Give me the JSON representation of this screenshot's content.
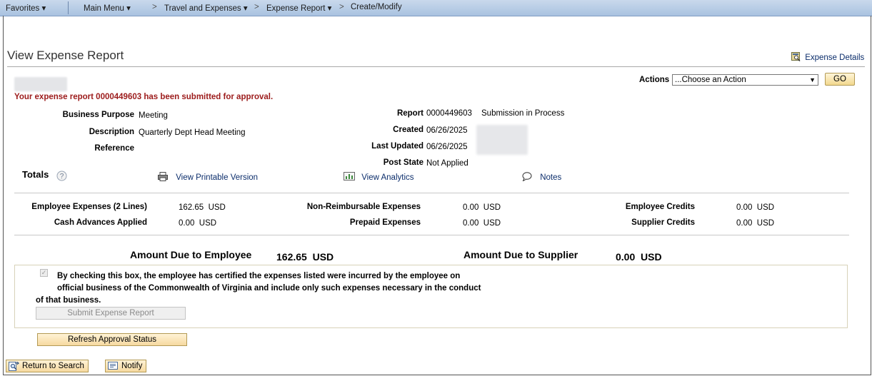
{
  "nav": {
    "favorites": "Favorites",
    "main_menu": "Main Menu",
    "crumb_sep": ">",
    "travel": "Travel and Expenses",
    "expense_report": "Expense Report",
    "create_modify": "Create/Modify"
  },
  "page": {
    "title": "View Expense Report",
    "expense_details_link": "Expense Details",
    "message": "Your expense report 0000449603 has been submitted for approval."
  },
  "actions": {
    "label": "Actions",
    "selected": "...Choose an Action",
    "go": "GO"
  },
  "header_fields": {
    "business_purpose_label": "Business Purpose",
    "business_purpose": "Meeting",
    "description_label": "Description",
    "description": "Quarterly Dept Head Meeting",
    "reference_label": "Reference",
    "reference": "",
    "report_label": "Report",
    "report_id": "0000449603",
    "report_status": "Submission in Process",
    "created_label": "Created",
    "created": "06/26/2025",
    "last_updated_label": "Last Updated",
    "last_updated": "06/26/2025",
    "post_state_label": "Post State",
    "post_state": "Not Applied"
  },
  "links": {
    "totals": "Totals",
    "printable": "View Printable Version",
    "analytics": "View Analytics",
    "notes": "Notes"
  },
  "totals": {
    "employee_expenses_label": "Employee Expenses (2 Lines)",
    "employee_expenses": "162.65",
    "cash_advances_label": "Cash Advances Applied",
    "cash_advances": "0.00",
    "non_reimbursable_label": "Non-Reimbursable Expenses",
    "non_reimbursable": "0.00",
    "prepaid_label": "Prepaid Expenses",
    "prepaid": "0.00",
    "employee_credits_label": "Employee Credits",
    "employee_credits": "0.00",
    "supplier_credits_label": "Supplier Credits",
    "supplier_credits": "0.00",
    "currency": "USD"
  },
  "due": {
    "employee_label": "Amount Due to Employee",
    "employee_amount": "162.65",
    "supplier_label": "Amount Due to Supplier",
    "supplier_amount": "0.00",
    "currency": "USD"
  },
  "certification": {
    "checked": true,
    "line1": "By checking this box, the employee has certified the expenses listed were incurred by the employee on",
    "line2": "official business of the Commonwealth of Virginia and include only such expenses necessary in the conduct",
    "line3": "of that business.",
    "submit_button": "Submit Expense Report"
  },
  "buttons": {
    "refresh": "Refresh Approval Status",
    "return_to_search": "Return to Search",
    "notify": "Notify"
  },
  "colors": {
    "nav_bg": "#b8cde6",
    "message": "#9c1b1b",
    "link": "#0b2d6b",
    "button_bg": "#f6d9a0"
  }
}
